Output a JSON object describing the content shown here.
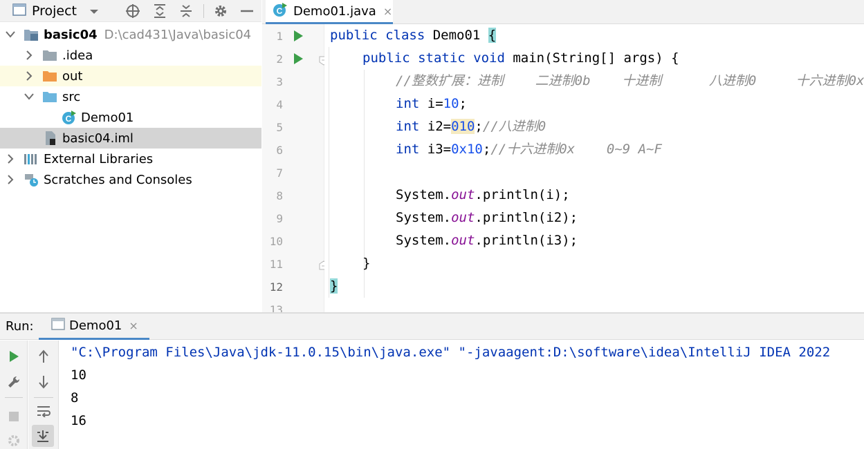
{
  "project_panel": {
    "title": "Project",
    "tree": [
      {
        "label": "basic04",
        "path": "D:\\cad431\\Java\\basic04",
        "type": "module",
        "expanded": true
      },
      {
        "label": ".idea",
        "type": "folder",
        "expanded": false
      },
      {
        "label": "out",
        "type": "folder-orange",
        "expanded": false
      },
      {
        "label": "src",
        "type": "folder-source",
        "expanded": true
      },
      {
        "label": "Demo01",
        "type": "java-class"
      },
      {
        "label": "basic04.iml",
        "type": "iml-file"
      },
      {
        "label": "External Libraries",
        "type": "libraries",
        "expanded": false
      },
      {
        "label": "Scratches and Consoles",
        "type": "scratches",
        "expanded": false
      }
    ]
  },
  "editor": {
    "tab": {
      "label": "Demo01.java",
      "close": "×"
    },
    "line_numbers": [
      "1",
      "2",
      "3",
      "4",
      "5",
      "6",
      "7",
      "8",
      "9",
      "10",
      "11",
      "12",
      "13"
    ],
    "code": {
      "l1": {
        "kw": "public class",
        "name": " Demo01 ",
        "brace": "{"
      },
      "l2": {
        "kw": "public static void",
        "rest": " main(String[] args) {"
      },
      "l3": {
        "comment": "//整数扩展：进制    二进制0b    十进制      八进制0     十六进制0x"
      },
      "l4": {
        "kw": "int",
        "rest": " i=",
        "num": "10",
        "end": ";"
      },
      "l5": {
        "kw": "int",
        "rest": " i2=",
        "num": "010",
        "end": ";",
        "comment": "//八进制0"
      },
      "l6": {
        "kw": "int",
        "rest": " i3=",
        "num": "0x10",
        "end": ";",
        "comment": "//十六进制0x    0~9 A~F"
      },
      "l8": {
        "pre": "System.",
        "field": "out",
        "post": ".println(i);"
      },
      "l9": {
        "pre": "System.",
        "field": "out",
        "post": ".println(i2);"
      },
      "l10": {
        "pre": "System.",
        "field": "out",
        "post": ".println(i3);"
      },
      "l11": {
        "text": "}"
      },
      "l12": {
        "brace": "}"
      }
    }
  },
  "run_panel": {
    "label": "Run:",
    "tab": {
      "label": "Demo01",
      "close": "×"
    },
    "output": [
      "\"C:\\Program Files\\Java\\jdk-11.0.15\\bin\\java.exe\" \"-javaagent:D:\\software\\idea\\IntelliJ IDEA 2022",
      "10",
      "8",
      "16"
    ]
  },
  "colors": {
    "keyword": "#0033b3",
    "number": "#1750eb",
    "comment": "#8c8c8c",
    "field": "#871094",
    "run_green": "#3c9f4a",
    "accent": "#4a88c7"
  }
}
